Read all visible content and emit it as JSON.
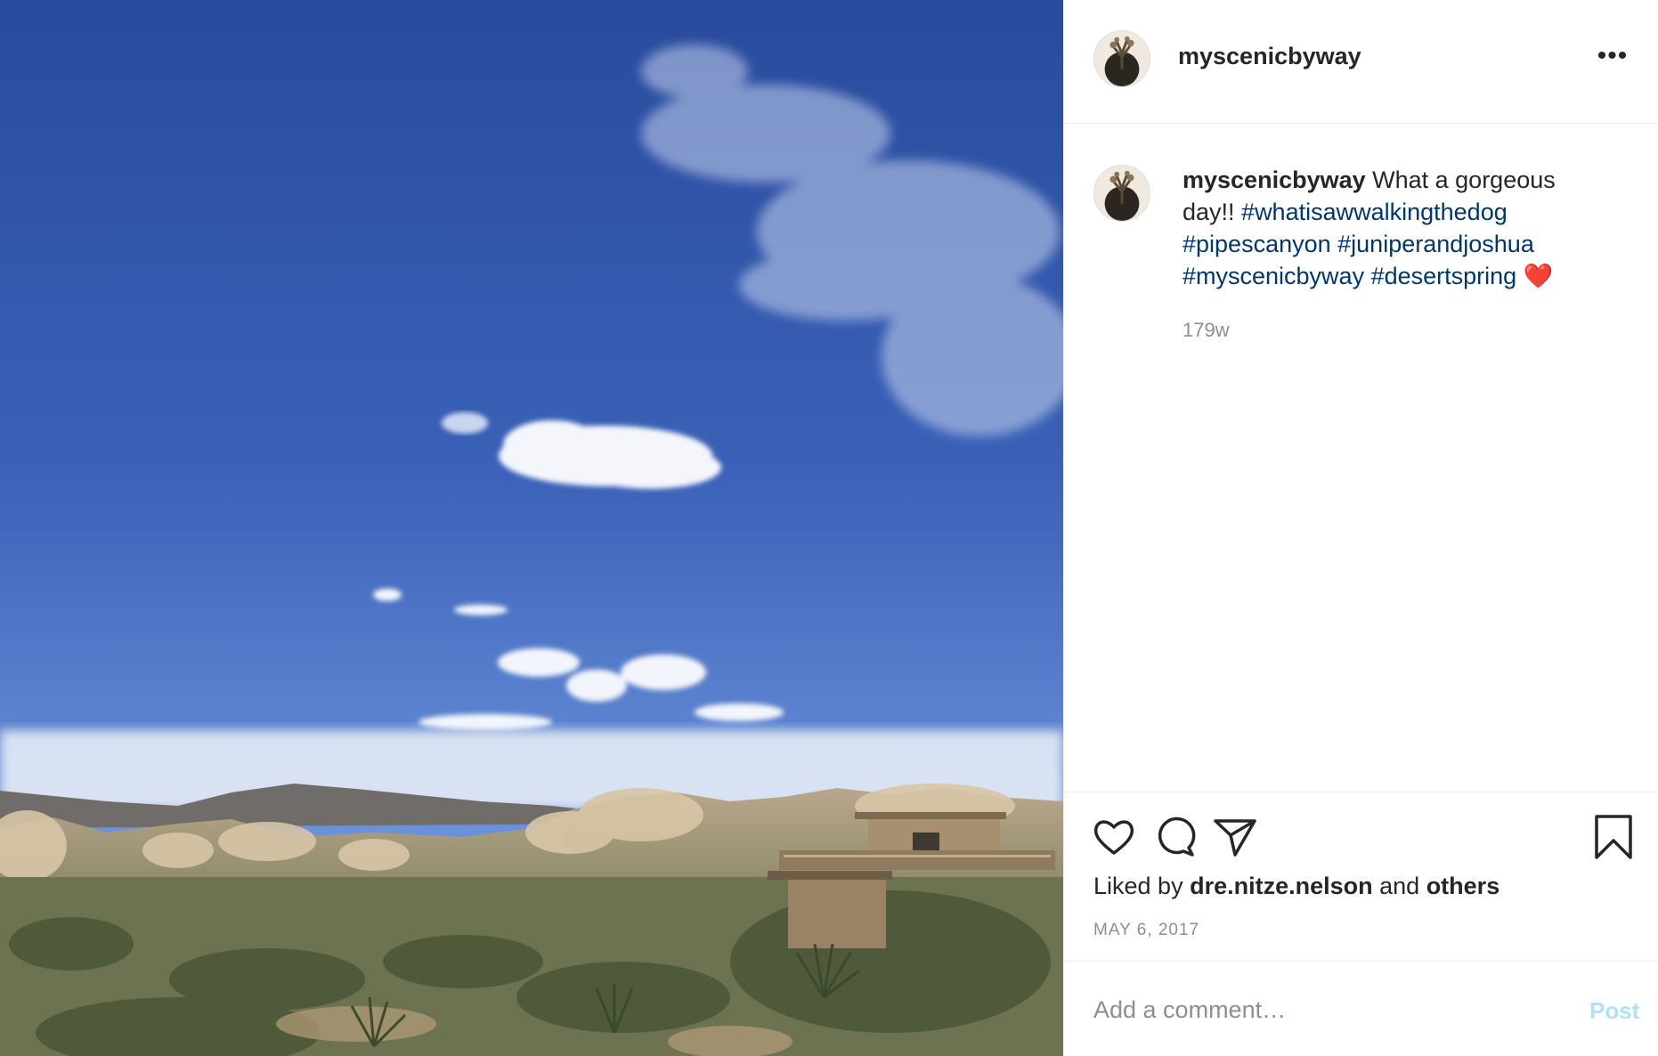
{
  "post": {
    "username": "myscenicbyway",
    "more_icon": "•••",
    "photo_alt": "desert-landscape-photo"
  },
  "caption": {
    "username": "myscenicbyway",
    "text": " What a gorgeous day!! ",
    "tags": [
      "#whatisawwalkingthedog",
      "#pipescanyon",
      "#juniperandjoshua",
      "#myscenicbyway",
      "#desertspring"
    ],
    "emoji": "❤️",
    "time_ago": "179w"
  },
  "actions": {
    "like_icon": "heart-outline-icon",
    "comment_icon": "comment-bubble-icon",
    "share_icon": "paper-plane-icon",
    "save_icon": "bookmark-icon"
  },
  "likes": {
    "prefix": "Liked by ",
    "user": "dre.nitze.nelson",
    "middle": " and ",
    "others": "others"
  },
  "date": "MAY 6, 2017",
  "comment": {
    "placeholder": "Add a comment…",
    "post_label": "Post"
  },
  "colors": {
    "link": "#00376b",
    "muted": "#8e8e8e",
    "post_disabled": "#b2dffc",
    "sky_top": "#2a4a9c",
    "sky_bottom": "#6c93db"
  }
}
